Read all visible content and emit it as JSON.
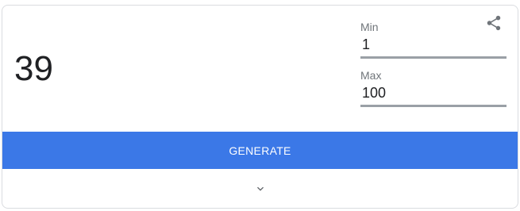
{
  "result": {
    "value": "39"
  },
  "min": {
    "label": "Min",
    "value": "1"
  },
  "max": {
    "label": "Max",
    "value": "100"
  },
  "generate": {
    "label": "GENERATE"
  },
  "icons": {
    "share": "share-icon",
    "expand": "chevron-down-icon"
  },
  "colors": {
    "accent": "#3b78e7",
    "text": "#202124",
    "label": "#70757a",
    "underline": "#9aa0a6",
    "border": "#dadce0"
  }
}
